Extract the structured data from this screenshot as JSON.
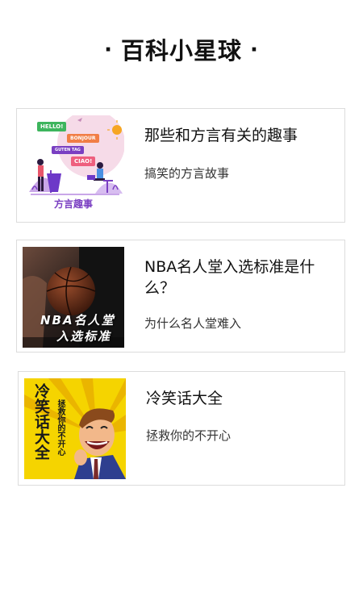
{
  "page": {
    "title": "百科小星球",
    "dot": "·"
  },
  "cards": [
    {
      "title": "那些和方言有关的趣事",
      "subtitle": "搞笑的方言故事",
      "thumb": {
        "caption": "方言趣事",
        "bubbles": [
          "HELLO!",
          "BONJOUR",
          "CIAO!",
          "GUTEN TAG"
        ]
      }
    },
    {
      "title": "NBA名人堂入选标准是什么？",
      "subtitle": "为什么名人堂难入",
      "thumb": {
        "line1": "NBA名人堂",
        "line2": "入选标准"
      }
    },
    {
      "title": "冷笑话大全",
      "subtitle": "拯救你的不开心",
      "thumb": {
        "big": "冷笑话大全",
        "small": "拯救你的不开心"
      }
    }
  ],
  "colors": {
    "accent_purple": "#7a3fc2",
    "card_border": "#dcdcdc",
    "joke_yellow": "#f5d400"
  }
}
